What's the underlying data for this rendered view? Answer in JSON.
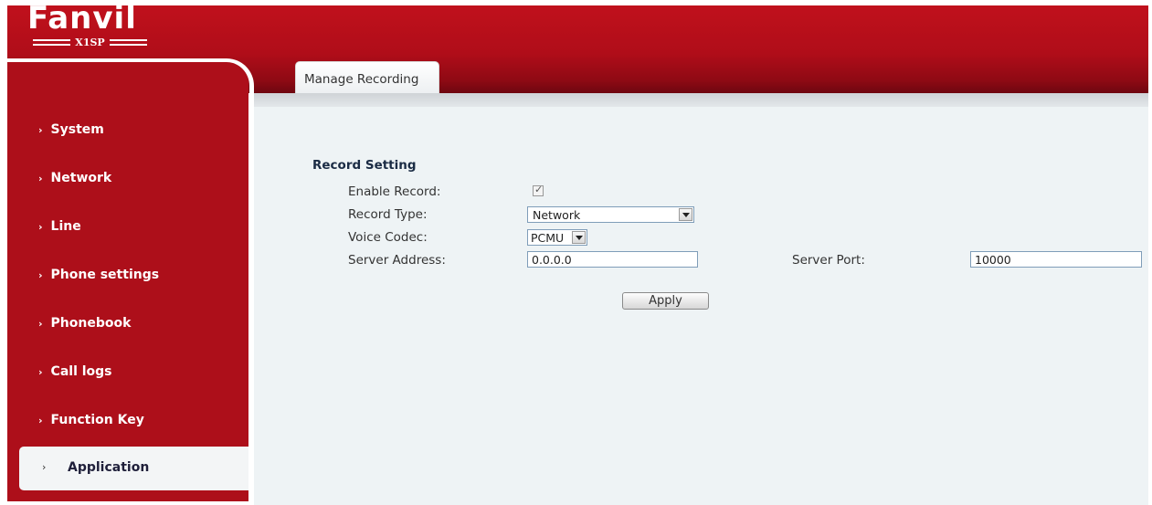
{
  "brand": {
    "logo_text": "Fanvil",
    "model": "X1SP",
    "primary_color": "#ad0f1a"
  },
  "tabs": [
    {
      "label": "Manage Recording",
      "active": true
    }
  ],
  "sidebar": {
    "items": [
      {
        "label": "System"
      },
      {
        "label": "Network"
      },
      {
        "label": "Line"
      },
      {
        "label": "Phone settings"
      },
      {
        "label": "Phonebook"
      },
      {
        "label": "Call logs"
      },
      {
        "label": "Function Key"
      },
      {
        "label": "Application",
        "active": true
      }
    ],
    "arrow_glyph": "›"
  },
  "form": {
    "section_title": "Record Setting",
    "enable_record": {
      "label": "Enable Record:",
      "checked": true
    },
    "record_type": {
      "label": "Record Type:",
      "value": "Network"
    },
    "voice_codec": {
      "label": "Voice Codec:",
      "value": "PCMU"
    },
    "server_address": {
      "label": "Server Address:",
      "value": "0.0.0.0"
    },
    "server_port": {
      "label": "Server Port:",
      "value": "10000"
    },
    "apply_label": "Apply"
  }
}
